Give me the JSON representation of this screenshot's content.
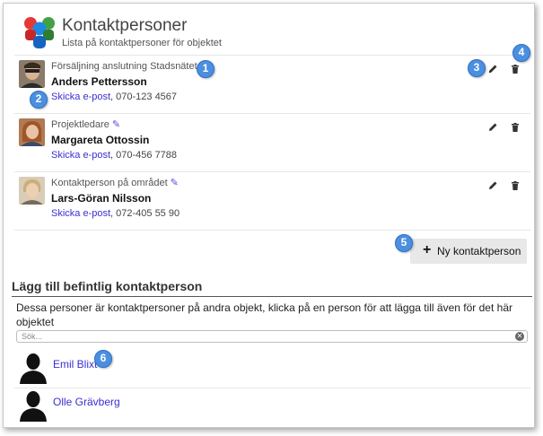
{
  "header": {
    "title": "Kontaktpersoner",
    "subtitle": "Lista på kontaktpersoner för objektet"
  },
  "contacts": [
    {
      "role": "Försäljning anslutning Stadsnätet",
      "name": "Anders Pettersson",
      "email_label": "Skicka e-post",
      "phone": ", 070-123 4567"
    },
    {
      "role": "Projektledare",
      "name": "Margareta Ottossin",
      "email_label": "Skicka e-post",
      "phone": ", 070-456 7788"
    },
    {
      "role": "Kontaktperson på området",
      "name": "Lars-Göran Nilsson",
      "email_label": "Skicka e-post",
      "phone": ", 072-405 55 90"
    }
  ],
  "new_contact_button": {
    "label": "Ny kontaktperson"
  },
  "add_existing": {
    "title": "Lägg till befintlig kontaktperson",
    "description": "Dessa personer är kontaktpersoner på andra objekt, klicka på en person för att lägga till även för det här objektet",
    "search_placeholder": "Sök...",
    "people": [
      {
        "name": "Emil Blixt"
      },
      {
        "name": "Olle Grävberg"
      }
    ]
  },
  "callouts": [
    "1",
    "2",
    "3",
    "4",
    "5",
    "6"
  ],
  "colors": {
    "link": "#3b2fd0",
    "edit_icon": "#5a4bd6",
    "callout": "#4b8fe0"
  },
  "icons": {
    "edit": "pencil-icon",
    "delete": "trash-icon",
    "add": "plus-icon",
    "clear": "clear-search-icon",
    "avatar_placeholder": "person-silhouette-icon"
  }
}
